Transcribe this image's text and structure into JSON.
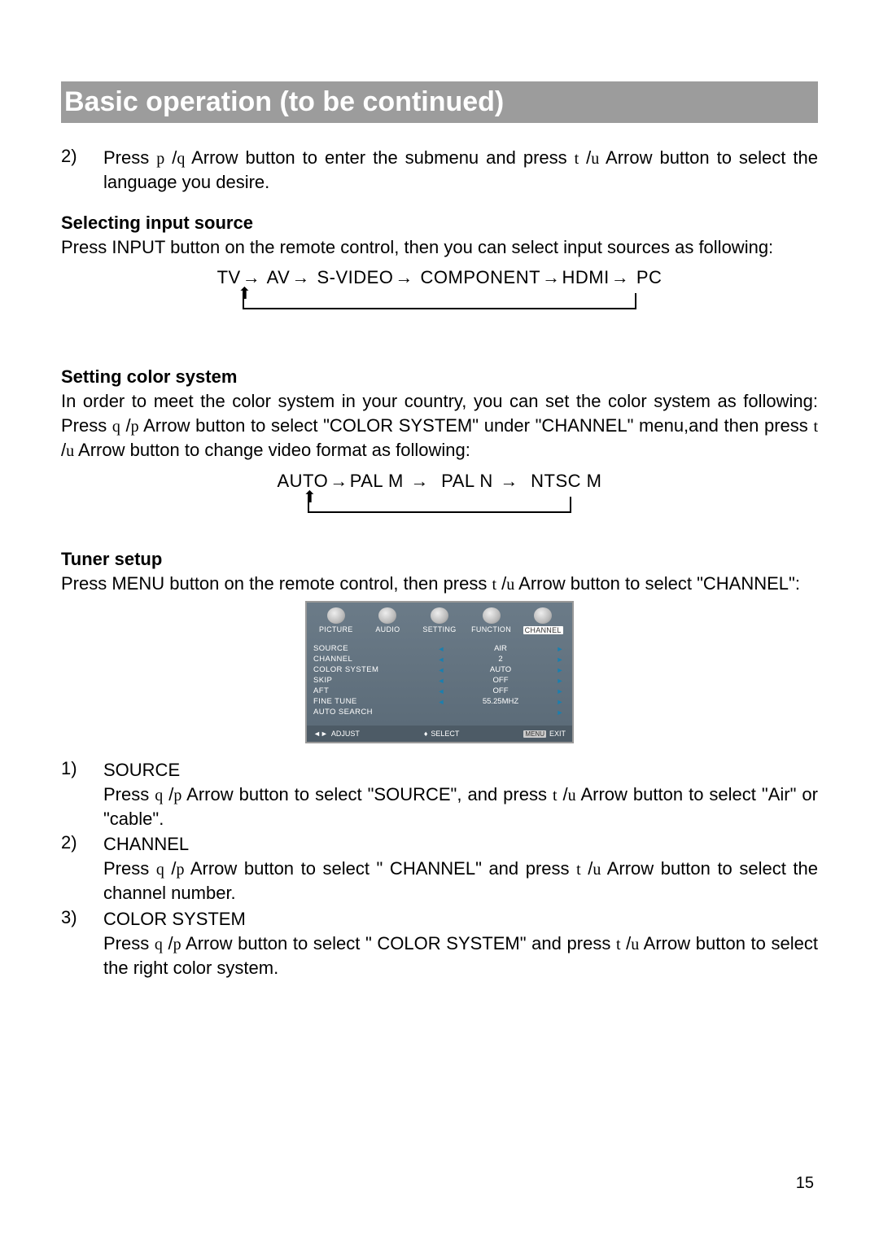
{
  "banner": "Basic operation (to be continued)",
  "step2": {
    "num": "2)",
    "text": "Press p /q Arrow button to enter the submenu and press t /u Arrow button to select the language you desire."
  },
  "selectInput": {
    "heading": "Selecting input source",
    "intro": "Press INPUT button on the remote control, then you can select input sources as following:",
    "chain": [
      "TV",
      "AV",
      "S-VIDEO",
      "COMPONENT",
      "HDMI",
      "PC"
    ]
  },
  "colorSystem": {
    "heading": "Setting color system",
    "intro": "In order to meet the color system in your country, you can set the color system as following: Press q /p Arrow button to select \"COLOR SYSTEM\" under \"CHANNEL\" menu,and then press t /u Arrow button to change video format as following:",
    "chain": [
      "AUTO",
      "PAL M",
      "PAL N",
      "NTSC M"
    ]
  },
  "tuner": {
    "heading": "Tuner setup",
    "intro": "Press MENU button on the remote control, then press t /u Arrow button to select \"CHANNEL\":"
  },
  "osd": {
    "tabs": [
      "PICTURE",
      "AUDIO",
      "SETTING",
      "FUNCTION",
      "CHANNEL"
    ],
    "activeTab": "CHANNEL",
    "rows": [
      {
        "label": "SOURCE",
        "value": "AIR",
        "left": true,
        "right": true
      },
      {
        "label": "CHANNEL",
        "value": "2",
        "left": true,
        "right": true
      },
      {
        "label": "COLOR SYSTEM",
        "value": "AUTO",
        "left": true,
        "right": true
      },
      {
        "label": "SKIP",
        "value": "OFF",
        "left": true,
        "right": true
      },
      {
        "label": "AFT",
        "value": "OFF",
        "left": true,
        "right": true
      },
      {
        "label": "FINE TUNE",
        "value": "55.25MHZ",
        "left": true,
        "right": true
      },
      {
        "label": "AUTO SEARCH",
        "value": "",
        "left": false,
        "right": true
      }
    ],
    "footer": {
      "adjust": "ADJUST",
      "select": "SELECT",
      "exitBadge": "MENU",
      "exit": "EXIT"
    }
  },
  "numbered": [
    {
      "num": "1)",
      "title": "SOURCE",
      "body": "Press q /p Arrow button to select \"SOURCE\", and press t /u Arrow button to select \"Air\" or \"cable\"."
    },
    {
      "num": "2)",
      "title": "CHANNEL",
      "body": "Press q /p Arrow button to select \" CHANNEL\" and press t /u Arrow button to select the channel number."
    },
    {
      "num": "3)",
      "title": "COLOR SYSTEM",
      "body": "Press q /p Arrow button to select \" COLOR SYSTEM\" and press t /u Arrow button to select the right color system."
    }
  ],
  "pageNum": "15"
}
